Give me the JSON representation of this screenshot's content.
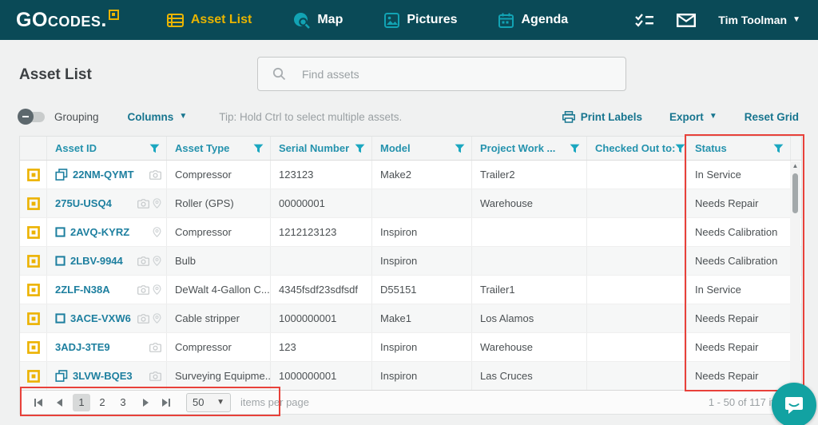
{
  "navbar": {
    "logo": {
      "go": "GO",
      "codes": "codes.",
      "mark_icon": "qr-logo-mark"
    },
    "tabs": [
      {
        "label": "Asset List",
        "icon": "asset-list-icon",
        "active": true
      },
      {
        "label": "Map",
        "icon": "map-icon",
        "active": false
      },
      {
        "label": "Pictures",
        "icon": "pictures-icon",
        "active": false
      },
      {
        "label": "Agenda",
        "icon": "agenda-icon",
        "active": false
      }
    ],
    "action_icons": [
      "tasks-icon",
      "mail-icon"
    ],
    "user": {
      "name": "Tim Toolman"
    }
  },
  "page": {
    "title": "Asset List"
  },
  "search": {
    "placeholder": "Find assets"
  },
  "toolbar": {
    "grouping_label": "Grouping",
    "columns_label": "Columns",
    "tip": "Tip: Hold Ctrl to select multiple assets.",
    "print_labels": "Print Labels",
    "export_label": "Export",
    "reset_grid": "Reset Grid"
  },
  "table": {
    "columns": [
      "Asset ID",
      "Asset Type",
      "Serial Number",
      "Model",
      "Project Work ...",
      "Checked Out to:",
      "Status"
    ],
    "rows": [
      {
        "id": "22NM-QYMT",
        "id_icon": "copies",
        "media": [
          "camera"
        ],
        "type": "Compressor",
        "serial": "123123",
        "model": "Make2",
        "project": "Trailer2",
        "checked_out": "",
        "status": "In Service"
      },
      {
        "id": "275U-USQ4",
        "id_icon": "",
        "media": [
          "camera",
          "pin"
        ],
        "type": "Roller (GPS)",
        "serial": "00000001",
        "model": "",
        "project": "Warehouse",
        "checked_out": "",
        "status": "Needs Repair"
      },
      {
        "id": "2AVQ-KYRZ",
        "id_icon": "square",
        "media": [
          "pin"
        ],
        "type": "Compressor",
        "serial": "1212123123",
        "model": "Inspiron",
        "project": "",
        "checked_out": "",
        "status": "Needs Calibration"
      },
      {
        "id": "2LBV-9944",
        "id_icon": "square",
        "media": [
          "camera",
          "pin"
        ],
        "type": "Bulb",
        "serial": "",
        "model": "Inspiron",
        "project": "",
        "checked_out": "",
        "status": "Needs Calibration"
      },
      {
        "id": "2ZLF-N38A",
        "id_icon": "",
        "media": [
          "camera",
          "pin"
        ],
        "type": "DeWalt 4-Gallon C...",
        "serial": "4345fsdf23sdfsdf",
        "model": "D55151",
        "project": "Trailer1",
        "checked_out": "",
        "status": "In Service"
      },
      {
        "id": "3ACE-VXW6",
        "id_icon": "square",
        "media": [
          "camera",
          "pin"
        ],
        "type": "Cable stripper",
        "serial": "1000000001",
        "model": "Make1",
        "project": "Los Alamos",
        "checked_out": "",
        "status": "Needs Repair"
      },
      {
        "id": "3ADJ-3TE9",
        "id_icon": "",
        "media": [
          "camera"
        ],
        "type": "Compressor",
        "serial": "123",
        "model": "Inspiron",
        "project": "Warehouse",
        "checked_out": "",
        "status": "Needs Repair"
      },
      {
        "id": "3LVW-BQE3",
        "id_icon": "copies",
        "media": [
          "camera"
        ],
        "type": "Surveying Equipme...",
        "serial": "1000000001",
        "model": "Inspiron",
        "project": "Las Cruces",
        "checked_out": "",
        "status": "Needs Repair"
      }
    ]
  },
  "pagination": {
    "pages": [
      "1",
      "2",
      "3"
    ],
    "active_page": "1",
    "page_size": "50",
    "items_per_page_label": "items per page",
    "range_label": "1 - 50 of 117 it"
  },
  "colors": {
    "navbar_bg": "#0a4a57",
    "brand_gold": "#e9b400",
    "nav_icon_teal": "#12a3b4",
    "link_teal": "#1d7f9f",
    "toolbar_link": "#17758f",
    "filter_icon": "#1ba7c0",
    "annotation_red": "#e8413a",
    "chat_bubble": "#12a2a2"
  }
}
